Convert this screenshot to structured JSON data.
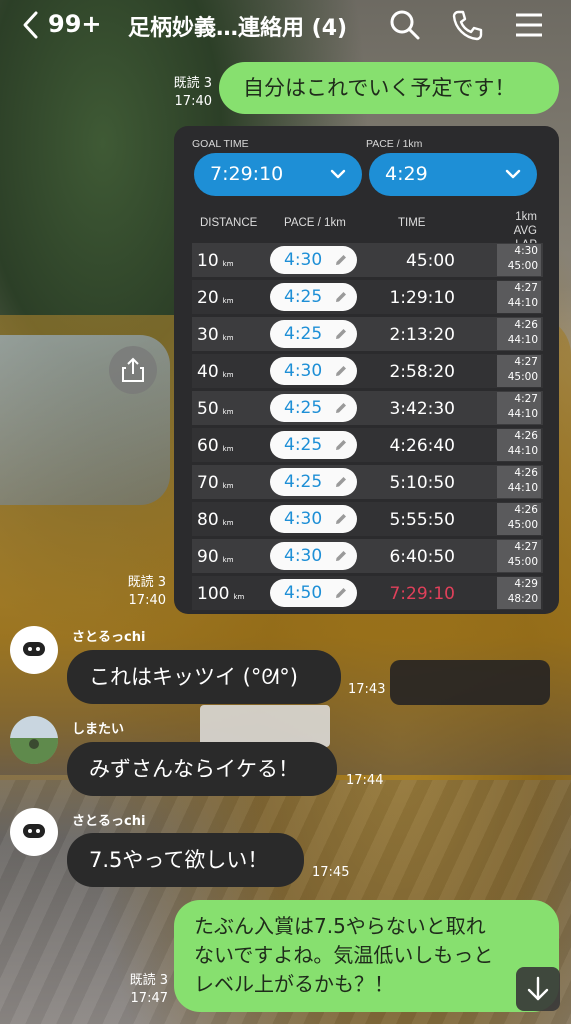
{
  "header": {
    "back_count": "99+",
    "title": "足柄妙義…連絡用 (4)"
  },
  "messages": {
    "m1": {
      "text": "自分はこれでいく予定です！",
      "read": "既読 3",
      "time": "17:40"
    },
    "m2": {
      "read": "既読 3",
      "time": "17:40"
    },
    "m3": {
      "sender": "さとるっchi",
      "text": "これはキッツイ (°ᘛ°)",
      "time": "17:43"
    },
    "m4": {
      "sender": "しまたい",
      "text": "みずさんならイケる！",
      "time": "17:44"
    },
    "m5": {
      "sender": "さとるっchi",
      "text": "7.5やって欲しい！",
      "time": "17:45"
    },
    "m6": {
      "lines": [
        "たぶん入賞は7.5やらないと取れ",
        "ないですよね。気温低いしもっと",
        "レベル上がるかも？！"
      ],
      "read": "既読 3",
      "time": "17:47"
    }
  },
  "pace_card": {
    "goal_label": "GOAL TIME",
    "goal_value": "7:29:10",
    "pace_label": "PACE / 1km",
    "pace_value": "4:29",
    "col_distance": "DISTANCE",
    "col_pace": "PACE / 1km",
    "col_time": "TIME",
    "col_lap_1": "1km AVG",
    "col_lap_2": "LAP",
    "unit": "km",
    "rows": [
      {
        "dist": "10",
        "pace": "4:30",
        "time": "45:00",
        "lap1": "4:30",
        "lap2": "45:00"
      },
      {
        "dist": "20",
        "pace": "4:25",
        "time": "1:29:10",
        "lap1": "4:27",
        "lap2": "44:10"
      },
      {
        "dist": "30",
        "pace": "4:25",
        "time": "2:13:20",
        "lap1": "4:26",
        "lap2": "44:10"
      },
      {
        "dist": "40",
        "pace": "4:30",
        "time": "2:58:20",
        "lap1": "4:27",
        "lap2": "45:00"
      },
      {
        "dist": "50",
        "pace": "4:25",
        "time": "3:42:30",
        "lap1": "4:27",
        "lap2": "44:10"
      },
      {
        "dist": "60",
        "pace": "4:25",
        "time": "4:26:40",
        "lap1": "4:26",
        "lap2": "44:10"
      },
      {
        "dist": "70",
        "pace": "4:25",
        "time": "5:10:50",
        "lap1": "4:26",
        "lap2": "44:10"
      },
      {
        "dist": "80",
        "pace": "4:30",
        "time": "5:55:50",
        "lap1": "4:26",
        "lap2": "45:00"
      },
      {
        "dist": "90",
        "pace": "4:30",
        "time": "6:40:50",
        "lap1": "4:27",
        "lap2": "45:00"
      },
      {
        "dist": "100",
        "pace": "4:50",
        "time": "7:29:10",
        "lap1": "4:29",
        "lap2": "48:20"
      }
    ]
  },
  "colors": {
    "bubble_green": "#87e06f",
    "accent_blue": "#1e8fd6",
    "final_time_red": "#e0405a"
  },
  "icons": [
    "chevron-left-icon",
    "search-icon",
    "phone-icon",
    "menu-icon",
    "share-icon",
    "arrow-down-icon",
    "pencil-icon"
  ]
}
